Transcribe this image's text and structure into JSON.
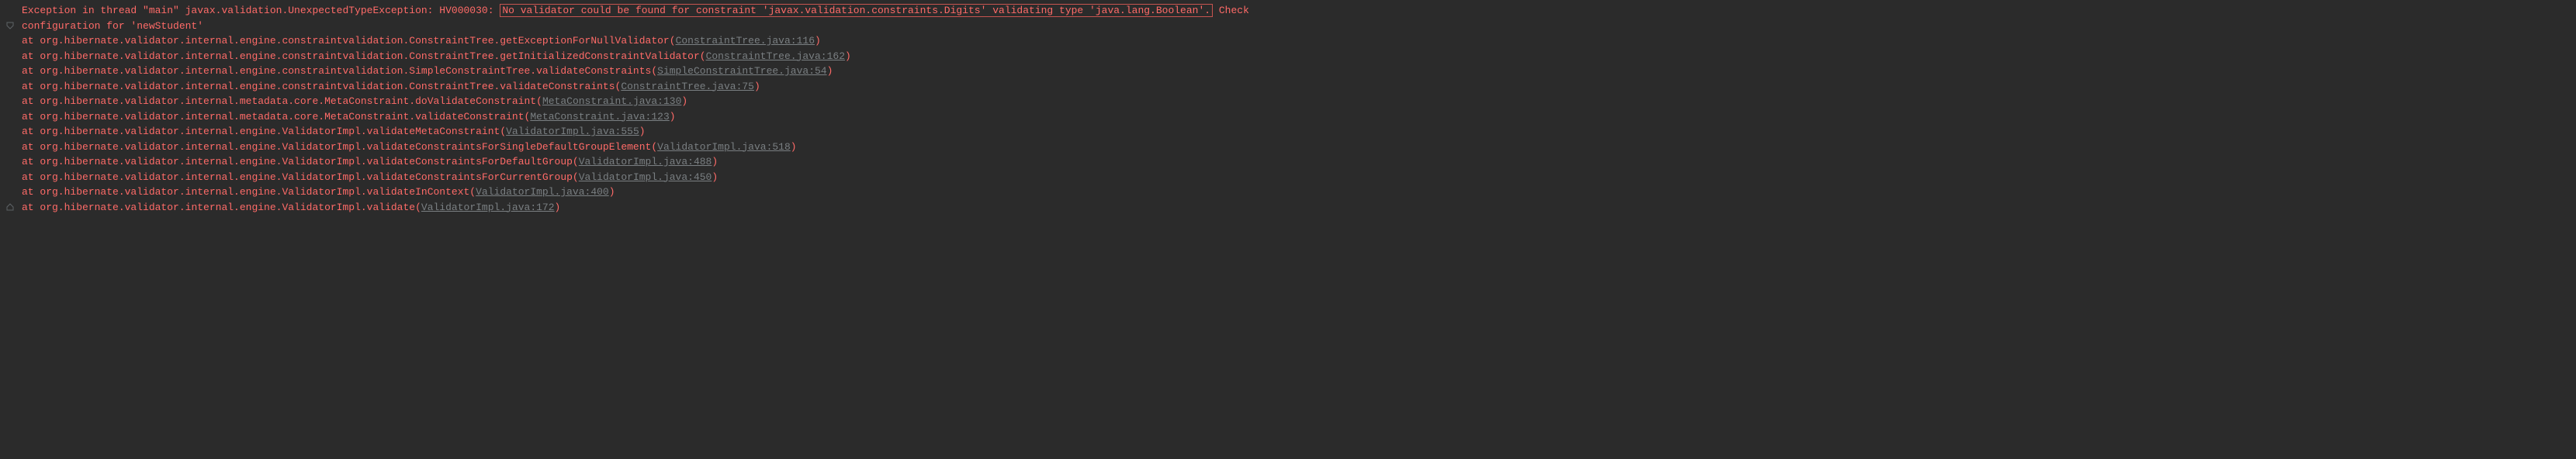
{
  "exception_line": {
    "prefix": "Exception in thread \"main\" javax.validation.UnexpectedTypeException: HV000030: ",
    "boxed": "No validator could be found for constraint 'javax.validation.constraints.Digits' validating type 'java.lang.Boolean'.",
    "suffix": " Check "
  },
  "continuation": "configuration for 'newStudent'",
  "frames": [
    {
      "indent": "    at ",
      "call": "org.hibernate.validator.internal.engine.constraintvalidation.ConstraintTree.getExceptionForNullValidator",
      "open": "(",
      "link": "ConstraintTree.java:116",
      "close": ")"
    },
    {
      "indent": "    at ",
      "call": "org.hibernate.validator.internal.engine.constraintvalidation.ConstraintTree.getInitializedConstraintValidator",
      "open": "(",
      "link": "ConstraintTree.java:162",
      "close": ")"
    },
    {
      "indent": "    at ",
      "call": "org.hibernate.validator.internal.engine.constraintvalidation.SimpleConstraintTree.validateConstraints",
      "open": "(",
      "link": "SimpleConstraintTree.java:54",
      "close": ")"
    },
    {
      "indent": "    at ",
      "call": "org.hibernate.validator.internal.engine.constraintvalidation.ConstraintTree.validateConstraints",
      "open": "(",
      "link": "ConstraintTree.java:75",
      "close": ")"
    },
    {
      "indent": "    at ",
      "call": "org.hibernate.validator.internal.metadata.core.MetaConstraint.doValidateConstraint",
      "open": "(",
      "link": "MetaConstraint.java:130",
      "close": ")"
    },
    {
      "indent": "    at ",
      "call": "org.hibernate.validator.internal.metadata.core.MetaConstraint.validateConstraint",
      "open": "(",
      "link": "MetaConstraint.java:123",
      "close": ")"
    },
    {
      "indent": "    at ",
      "call": "org.hibernate.validator.internal.engine.ValidatorImpl.validateMetaConstraint",
      "open": "(",
      "link": "ValidatorImpl.java:555",
      "close": ")"
    },
    {
      "indent": "    at ",
      "call": "org.hibernate.validator.internal.engine.ValidatorImpl.validateConstraintsForSingleDefaultGroupElement",
      "open": "(",
      "link": "ValidatorImpl.java:518",
      "close": ")"
    },
    {
      "indent": "    at ",
      "call": "org.hibernate.validator.internal.engine.ValidatorImpl.validateConstraintsForDefaultGroup",
      "open": "(",
      "link": "ValidatorImpl.java:488",
      "close": ")"
    },
    {
      "indent": "    at ",
      "call": "org.hibernate.validator.internal.engine.ValidatorImpl.validateConstraintsForCurrentGroup",
      "open": "(",
      "link": "ValidatorImpl.java:450",
      "close": ")"
    },
    {
      "indent": "    at ",
      "call": "org.hibernate.validator.internal.engine.ValidatorImpl.validateInContext",
      "open": "(",
      "link": "ValidatorImpl.java:400",
      "close": ")"
    },
    {
      "indent": "    at ",
      "call": "org.hibernate.validator.internal.engine.ValidatorImpl.validate",
      "open": "(",
      "link": "ValidatorImpl.java:172",
      "close": ")"
    }
  ],
  "gutter": {
    "collapse_top_index": 1,
    "collapse_bottom_index": 13
  }
}
